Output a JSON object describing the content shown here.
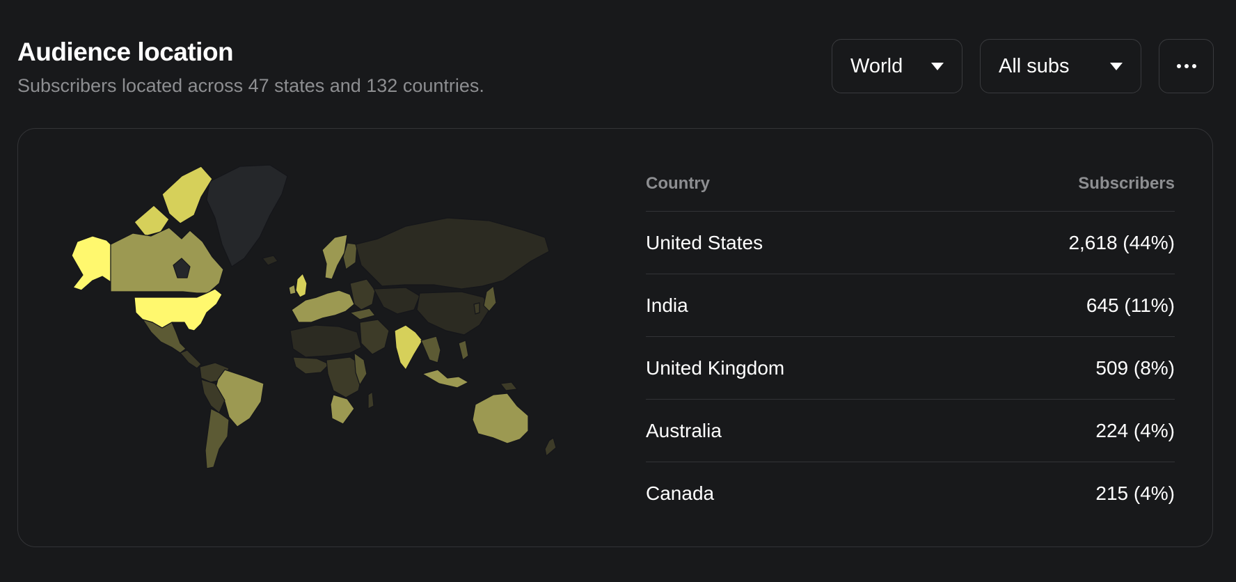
{
  "header": {
    "title": "Audience location",
    "subtitle": "Subscribers located across 47 states and 132 countries."
  },
  "controls": {
    "region_value": "World",
    "filter_value": "All subs",
    "more_icon": "more-horizontal-icon"
  },
  "map": {
    "colors": {
      "max": "#fff86e",
      "high": "#d6d05a",
      "mid": "#9c9952",
      "low": "#5c5a34",
      "lower": "#3d3b28",
      "min": "#2c2b22",
      "none": "#25272a",
      "border": "#15161a"
    }
  },
  "table": {
    "columns": [
      "Country",
      "Subscribers"
    ],
    "rows": [
      {
        "country": "United States",
        "subscribers": "2,618 (44%)"
      },
      {
        "country": "India",
        "subscribers": "645 (11%)"
      },
      {
        "country": "United Kingdom",
        "subscribers": "509 (8%)"
      },
      {
        "country": "Australia",
        "subscribers": "224 (4%)"
      },
      {
        "country": "Canada",
        "subscribers": "215 (4%)"
      }
    ]
  }
}
